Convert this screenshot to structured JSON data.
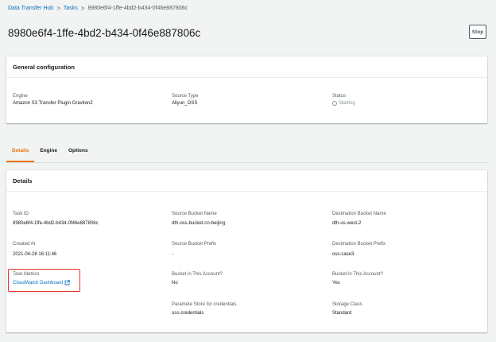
{
  "breadcrumb": {
    "items": [
      "Data Transfer Hub",
      "Tasks",
      "8980e6f4-1ffe-4bd2-b434-0f46e887806c"
    ],
    "separator": ">"
  },
  "page": {
    "title": "8980e6f4-1ffe-4bd2-b434-0f46e887806c",
    "stop_label": "Stop"
  },
  "general": {
    "header": "General configuration",
    "engine_label": "Engine",
    "engine_value": "Amazon S3 Transfer Plugin Graviton2",
    "source_type_label": "Source Type",
    "source_type_value": "Aliyun_OSS",
    "status_label": "Status",
    "status_value": "Starting"
  },
  "tabs": [
    "Details",
    "Engine",
    "Options"
  ],
  "details": {
    "header": "Details",
    "task_id_label": "Task ID",
    "task_id_value": "8980e6f4-1ffe-4bd2-b434-0f46e887806c",
    "created_at_label": "Created At",
    "created_at_value": "2021-04-28 16:11:46",
    "task_metrics_label": "Task Metrics",
    "task_metrics_link": "CloudWatch Dashboard",
    "source_bucket_name_label": "Source Bucket Name",
    "source_bucket_name_value": "dth-oss-bucket-cn-beijing",
    "source_bucket_prefix_label": "Source Bucket Prefix",
    "source_bucket_prefix_value": "-",
    "source_bucket_in_account_label": "Bucket in This Account?",
    "source_bucket_in_account_value": "No",
    "parameter_store_label": "Paramete Store for credentials",
    "parameter_store_value": "oss-credentials",
    "dest_bucket_name_label": "Destination Bucket Name",
    "dest_bucket_name_value": "dth-us-west-2",
    "dest_bucket_prefix_label": "Destination Bucket Prefix",
    "dest_bucket_prefix_value": "oss-case3",
    "dest_bucket_in_account_label": "Bucket in This Account?",
    "dest_bucket_in_account_value": "Yes",
    "storage_class_label": "Storage Class",
    "storage_class_value": "Standard"
  },
  "colors": {
    "link": "#0073bb",
    "active_tab": "#ec7211",
    "highlight_box": "#e5322d",
    "background": "#f2f3f3"
  },
  "icons": {
    "status": "spinner-icon",
    "external_link": "external-link-icon"
  }
}
